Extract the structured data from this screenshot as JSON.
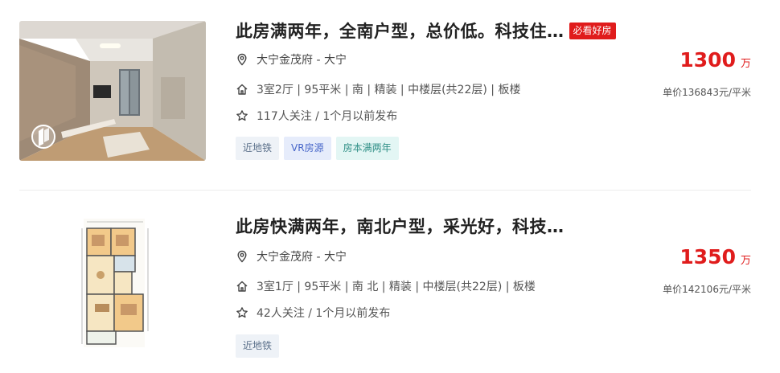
{
  "listings": [
    {
      "title": "此房满两年，全南户型，总价低。科技住…",
      "badge": "必看好房",
      "location": "大宁金茂府 - 大宁",
      "attributes": "3室2厅 | 95平米 | 南 | 精装 | 中楼层(共22层) | 板楼",
      "follow": "117人关注 / 1个月以前发布",
      "tags": [
        "近地铁",
        "VR房源",
        "房本满两年"
      ],
      "price": "1300",
      "price_unit": "万",
      "unit_price": "单价136843元/平米"
    },
    {
      "title": "此房快满两年，南北户型，采光好，科技…",
      "location": "大宁金茂府 - 大宁",
      "attributes": "3室1厅 | 95平米 | 南 北 | 精装 | 中楼层(共22层) | 板楼",
      "follow": "42人关注 / 1个月以前发布",
      "tags": [
        "近地铁"
      ],
      "price": "1350",
      "price_unit": "万",
      "unit_price": "单价142106元/平米"
    }
  ],
  "icons": {
    "location": "location-pin-icon",
    "house": "house-icon",
    "star": "star-icon",
    "vr": "vr-logo-icon"
  },
  "colors": {
    "accent_red": "#e01c1c",
    "tag_gray_text": "#5b708a",
    "tag_blue_text": "#4766c9",
    "tag_cyan_text": "#2f8f86"
  }
}
